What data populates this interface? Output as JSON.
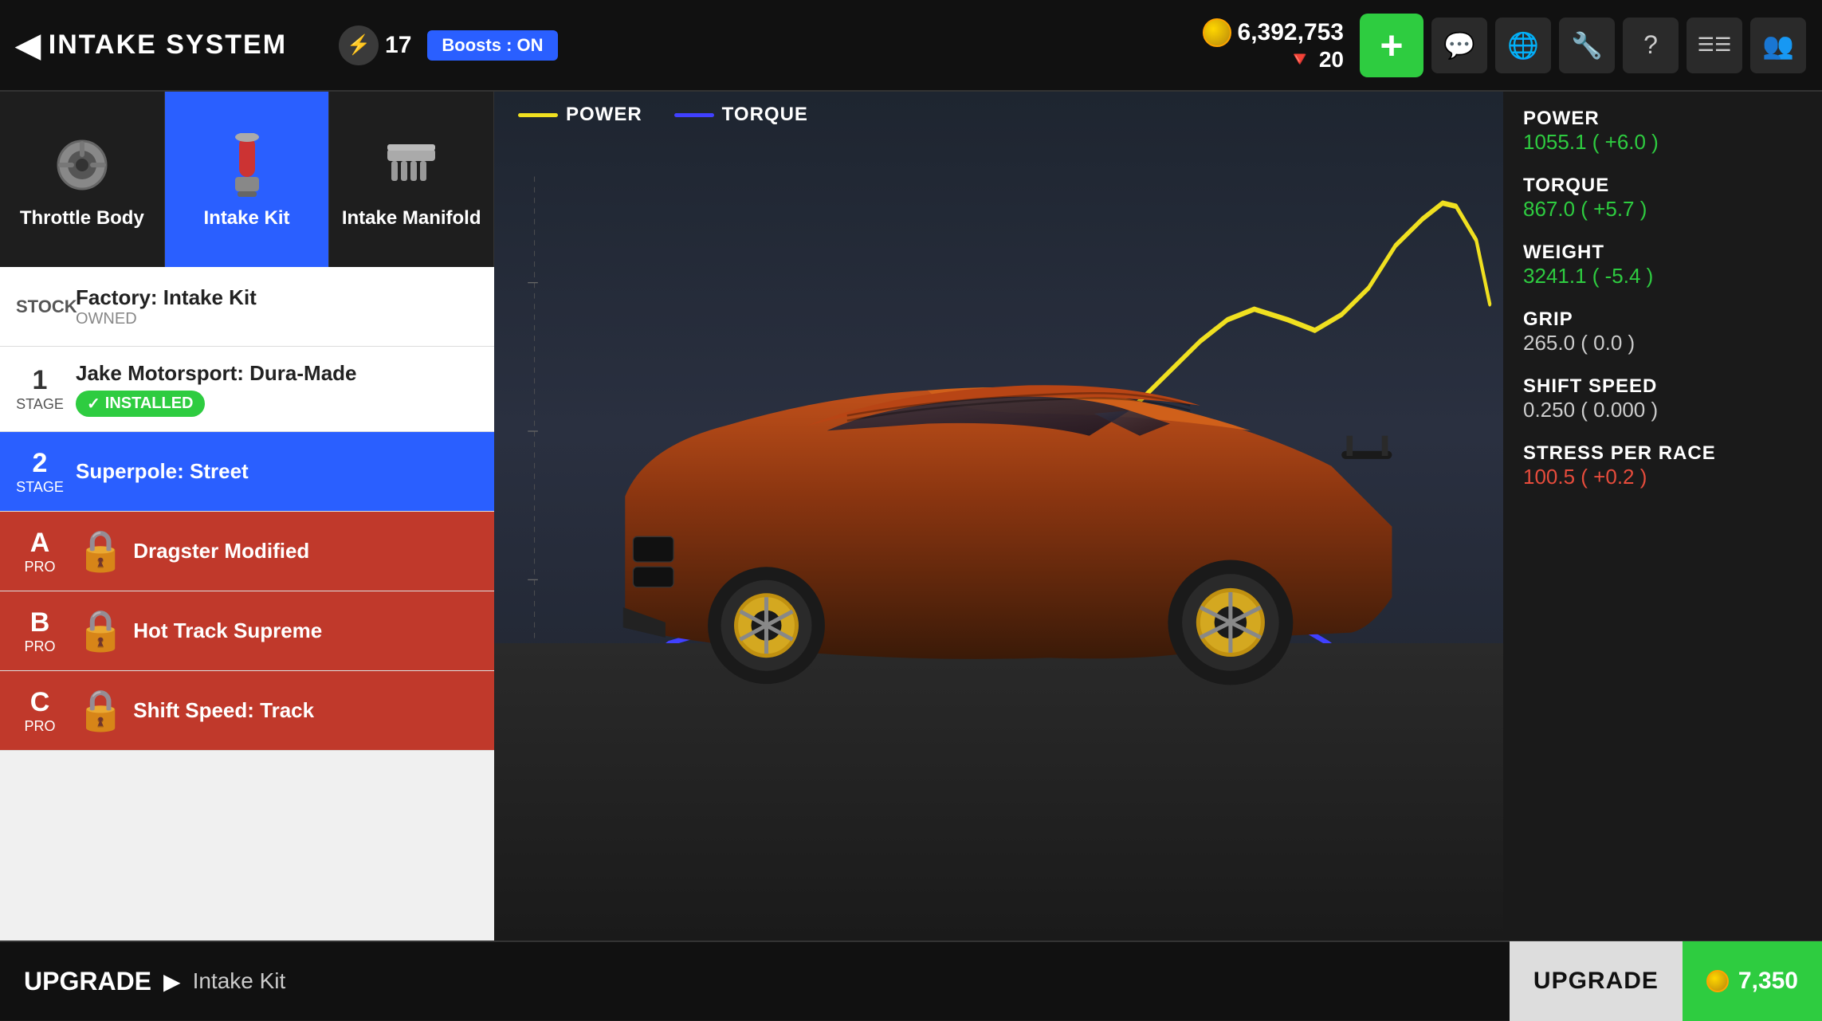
{
  "header": {
    "back_label": "INTAKE SYSTEM",
    "lightning_value": "17",
    "boost_label": "Boosts : ON",
    "coin_value": "6,392,753",
    "gem_value": "20",
    "add_label": "+",
    "icons": [
      "💬",
      "🌐",
      "🔧",
      "?",
      "☰",
      "👥"
    ]
  },
  "tabs": [
    {
      "id": "throttle",
      "label": "Throttle Body",
      "active": false
    },
    {
      "id": "intake_kit",
      "label": "Intake Kit",
      "active": true
    },
    {
      "id": "intake_manifold",
      "label": "Intake Manifold",
      "active": false
    }
  ],
  "upgrades": [
    {
      "stage": "STOCK",
      "stage_num": "",
      "name": "Factory: Intake Kit",
      "sub": "OWNED",
      "type": "stock",
      "locked": false,
      "selected": false,
      "installed": false
    },
    {
      "stage": "1",
      "stage_text": "STAGE",
      "name": "Jake Motorsport: Dura-Made",
      "sub": "",
      "type": "stage",
      "locked": false,
      "selected": false,
      "installed": true
    },
    {
      "stage": "2",
      "stage_text": "STAGE",
      "name": "Superpole: Street",
      "sub": "",
      "type": "stage",
      "locked": false,
      "selected": true,
      "installed": false
    },
    {
      "stage": "A",
      "stage_text": "PRO",
      "name": "Dragster Modified",
      "sub": "",
      "type": "pro",
      "locked": true,
      "selected": false,
      "installed": false
    },
    {
      "stage": "B",
      "stage_text": "PRO",
      "name": "Hot Track Supreme",
      "sub": "",
      "type": "pro",
      "locked": true,
      "selected": false,
      "installed": false
    },
    {
      "stage": "C",
      "stage_text": "PRO",
      "name": "Shift Speed: Track",
      "sub": "",
      "type": "pro",
      "locked": true,
      "selected": false,
      "installed": false
    }
  ],
  "chart": {
    "power_label": "POWER",
    "torque_label": "TORQUE"
  },
  "stats": [
    {
      "name": "POWER",
      "value": "1055.1 ( +6.0 )",
      "type": "positive"
    },
    {
      "name": "TORQUE",
      "value": "867.0 ( +5.7 )",
      "type": "positive"
    },
    {
      "name": "WEIGHT",
      "value": "3241.1 ( -5.4 )",
      "type": "positive"
    },
    {
      "name": "GRIP",
      "value": "265.0 ( 0.0 )",
      "type": "neutral"
    },
    {
      "name": "SHIFT SPEED",
      "value": "0.250 ( 0.000 )",
      "type": "neutral"
    },
    {
      "name": "STRESS PER RACE",
      "value": "100.5 ( +0.2 )",
      "type": "negative"
    }
  ],
  "bottom_bar": {
    "upgrade_label": "UPGRADE",
    "item_name": "Intake Kit",
    "btn_label": "UPGRADE",
    "btn_cost": "7,350"
  }
}
